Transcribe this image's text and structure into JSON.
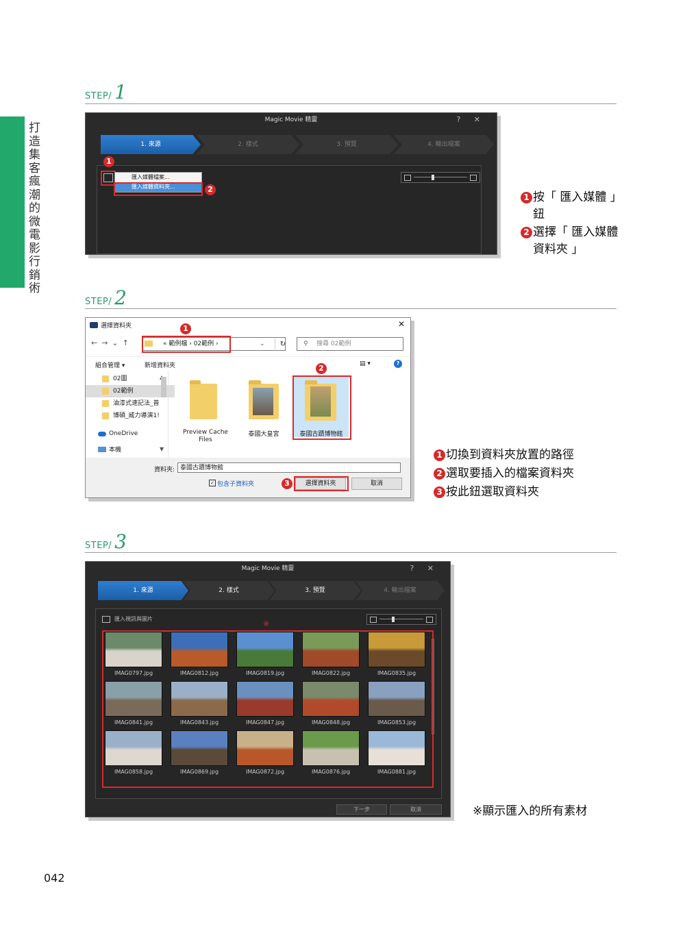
{
  "side_tab": {
    "text": "打造集客瘋潮的微電影行銷術",
    "color": "#22a86b"
  },
  "steps": [
    {
      "label": "STEP/",
      "num": "1"
    },
    {
      "label": "STEP/",
      "num": "2"
    },
    {
      "label": "STEP/",
      "num": "3"
    }
  ],
  "step1": {
    "window_title": "Magic Movie 精靈",
    "window_buttons": "? ✕",
    "tabs": [
      "1. 來源",
      "2. 樣式",
      "3. 預覽",
      "4. 輸出檔案"
    ],
    "menu": [
      "匯入媒體檔案...",
      "匯入媒體資料夾..."
    ],
    "badges": [
      "1",
      "2"
    ],
    "callouts": [
      {
        "num": "1",
        "lines": [
          "按「 匯入媒體 」",
          "鈕"
        ]
      },
      {
        "num": "2",
        "lines": [
          "選擇「 匯入媒體",
          "資料夾 」"
        ]
      }
    ]
  },
  "step2": {
    "title": "選擇資料夾",
    "close": "✕",
    "breadcrumb": "«  範例檔  ›  02範例  ›",
    "search_placeholder": "搜尋 02範例",
    "organize": "組合管理 ▾",
    "new_folder": "新增資料夾",
    "help": "?",
    "nav": [
      "02圖",
      "02範例",
      "油漆式速記法_普",
      "博碩_威力導演1!",
      "OneDrive",
      "本機"
    ],
    "folders": [
      "Preview Cache Files",
      "泰國大皇宮",
      "泰國古蹟博物館"
    ],
    "folder_label": "資料夾:",
    "folder_value": "泰國古蹟博物館",
    "include_sub": "包含子資料夾",
    "select_button": "選擇資料夾",
    "cancel_button": "取消",
    "badges": [
      "1",
      "2",
      "3"
    ],
    "callouts": [
      {
        "num": "1",
        "text": "切換到資料夾放置的路徑"
      },
      {
        "num": "2",
        "text": "選取要插入的檔案資料夾"
      },
      {
        "num": "3",
        "text": "按此鈕選取資料夾"
      }
    ]
  },
  "step3": {
    "window_title": "Magic Movie 精靈",
    "window_buttons": "? ✕",
    "tabs": [
      "1. 來源",
      "2. 樣式",
      "3. 預覽",
      "4. 輸出檔案"
    ],
    "import_label": "匯入視訊與圖片",
    "mark": "※",
    "files": [
      "IMAG0797.jpg",
      "IMAG0812.jpg",
      "IMAG0819.jpg",
      "IMAG0822.jpg",
      "IMAG0835.jpg",
      "IMAG0841.jpg",
      "IMAG0843.jpg",
      "IMAG0847.jpg",
      "IMAG0848.jpg",
      "IMAG0853.jpg",
      "IMAG0858.jpg",
      "IMAG0869.jpg",
      "IMAG0872.jpg",
      "IMAG0876.jpg",
      "IMAG0881.jpg"
    ],
    "next_button": "下一步",
    "cancel_button": "取消",
    "callout": "※顯示匯入的所有素材"
  },
  "page_number": "042",
  "colors": {
    "accent_green": "#22a86b",
    "highlight_red": "#d62a2a",
    "tab_blue": "#2f7fd0"
  }
}
